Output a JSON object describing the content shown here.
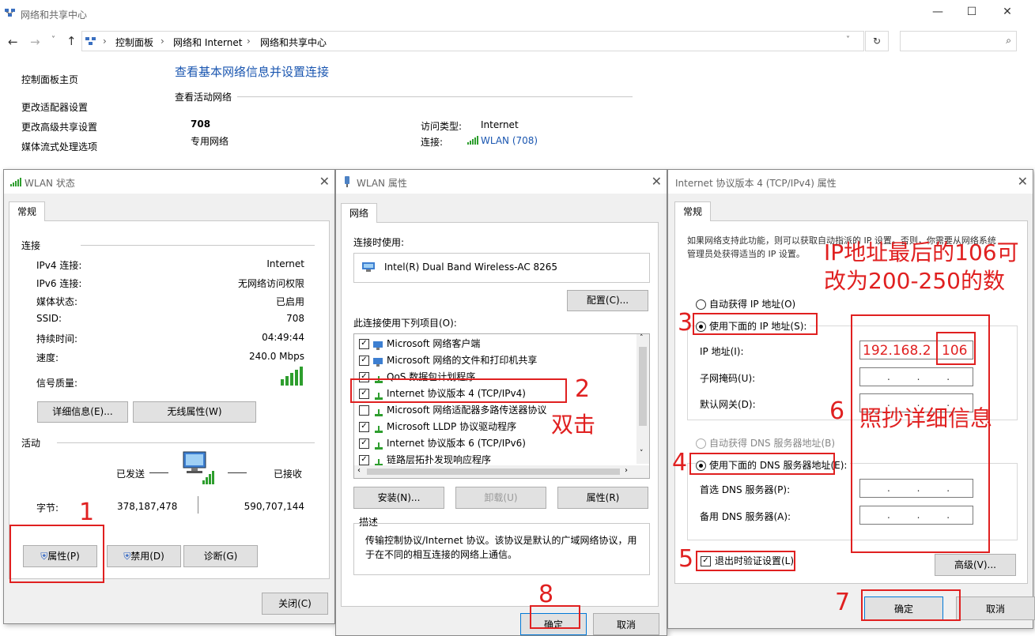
{
  "window": {
    "title": "网络和共享中心",
    "breadcrumb": [
      "控制面板",
      "网络和 Internet",
      "网络和共享中心"
    ]
  },
  "sidebar": {
    "items": [
      "控制面板主页",
      "更改适配器设置",
      "更改高级共享设置",
      "媒体流式处理选项"
    ]
  },
  "main": {
    "heading": "查看基本网络信息并设置连接",
    "active_networks_label": "查看活动网络",
    "network_name": "708",
    "network_type": "专用网络",
    "access_type_label": "访问类型:",
    "access_type_value": "Internet",
    "connection_label": "连接:",
    "connection_value": "WLAN (708)"
  },
  "wlan_status": {
    "title": "WLAN 状态",
    "tab": "常规",
    "connection_section": "连接",
    "rows": [
      {
        "label": "IPv4 连接:",
        "value": "Internet"
      },
      {
        "label": "IPv6 连接:",
        "value": "无网络访问权限"
      },
      {
        "label": "媒体状态:",
        "value": "已启用"
      },
      {
        "label": "SSID:",
        "value": "708"
      },
      {
        "label": "持续时间:",
        "value": "04:49:44"
      },
      {
        "label": "速度:",
        "value": "240.0 Mbps"
      }
    ],
    "signal_label": "信号质量:",
    "details_button": "详细信息(E)...",
    "wireless_props_button": "无线属性(W)",
    "activity_section": "活动",
    "sent_label": "已发送",
    "received_label": "已接收",
    "bytes_label": "字节:",
    "bytes_sent": "378,187,478",
    "bytes_received": "590,707,144",
    "properties_button": "属性(P)",
    "disable_button": "禁用(D)",
    "diagnose_button": "诊断(G)",
    "close_button": "关闭(C)"
  },
  "wlan_props": {
    "title": "WLAN 属性",
    "tab": "网络",
    "connect_using_label": "连接时使用:",
    "adapter": "Intel(R) Dual Band Wireless-AC 8265",
    "configure_button": "配置(C)...",
    "items_label": "此连接使用下列项目(O):",
    "items": [
      {
        "label": "Microsoft 网络客户端",
        "checked": true
      },
      {
        "label": "Microsoft 网络的文件和打印机共享",
        "checked": true
      },
      {
        "label": "QoS 数据包计划程序",
        "checked": true
      },
      {
        "label": "Internet 协议版本 4 (TCP/IPv4)",
        "checked": true
      },
      {
        "label": "Microsoft 网络适配器多路传送器协议",
        "checked": false
      },
      {
        "label": "Microsoft LLDP 协议驱动程序",
        "checked": true
      },
      {
        "label": "Internet 协议版本 6 (TCP/IPv6)",
        "checked": true
      },
      {
        "label": "链路层拓扑发现响应程序",
        "checked": true
      }
    ],
    "install_button": "安装(N)...",
    "uninstall_button": "卸载(U)",
    "properties_button": "属性(R)",
    "description_label": "描述",
    "description": "传输控制协议/Internet 协议。该协议是默认的广域网络协议，用于在不同的相互连接的网络上通信。",
    "ok_button": "确定",
    "cancel_button": "取消"
  },
  "ipv4": {
    "title": "Internet 协议版本 4 (TCP/IPv4) 属性",
    "tab": "常规",
    "intro": "如果网络支持此功能，则可以获取自动指派的 IP 设置。否则，你需要从网络系统管理员处获得适当的 IP 设置。",
    "auto_ip": "自动获得 IP 地址(O)",
    "manual_ip": "使用下面的 IP 地址(S):",
    "ip_label": "IP 地址(I):",
    "ip_value_prefix": "192.168.2",
    "ip_value_last": "106",
    "mask_label": "子网掩码(U):",
    "gateway_label": "默认网关(D):",
    "auto_dns": "自动获得 DNS 服务器地址(B)",
    "manual_dns": "使用下面的 DNS 服务器地址(E):",
    "dns1_label": "首选 DNS 服务器(P):",
    "dns2_label": "备用 DNS 服务器(A):",
    "validate_label": "退出时验证设置(L)",
    "advanced_button": "高级(V)...",
    "ok_button": "确定",
    "cancel_button": "取消",
    "empty_ip": ". . ."
  },
  "annotations": {
    "step1": "1",
    "step2": "2",
    "step2_text": "双击",
    "step3": "3",
    "step4": "4",
    "step5": "5",
    "step6": "6",
    "step6_text": "照抄详细信息",
    "step7": "7",
    "step8": "8",
    "ip_hint": "IP地址最后的106可改为200-250的数"
  },
  "colors": {
    "annotation_red": "#e02020",
    "link_blue": "#1a56b0",
    "dialog_bg": "#f0f0f0",
    "signal_green": "#2e9e2e"
  }
}
